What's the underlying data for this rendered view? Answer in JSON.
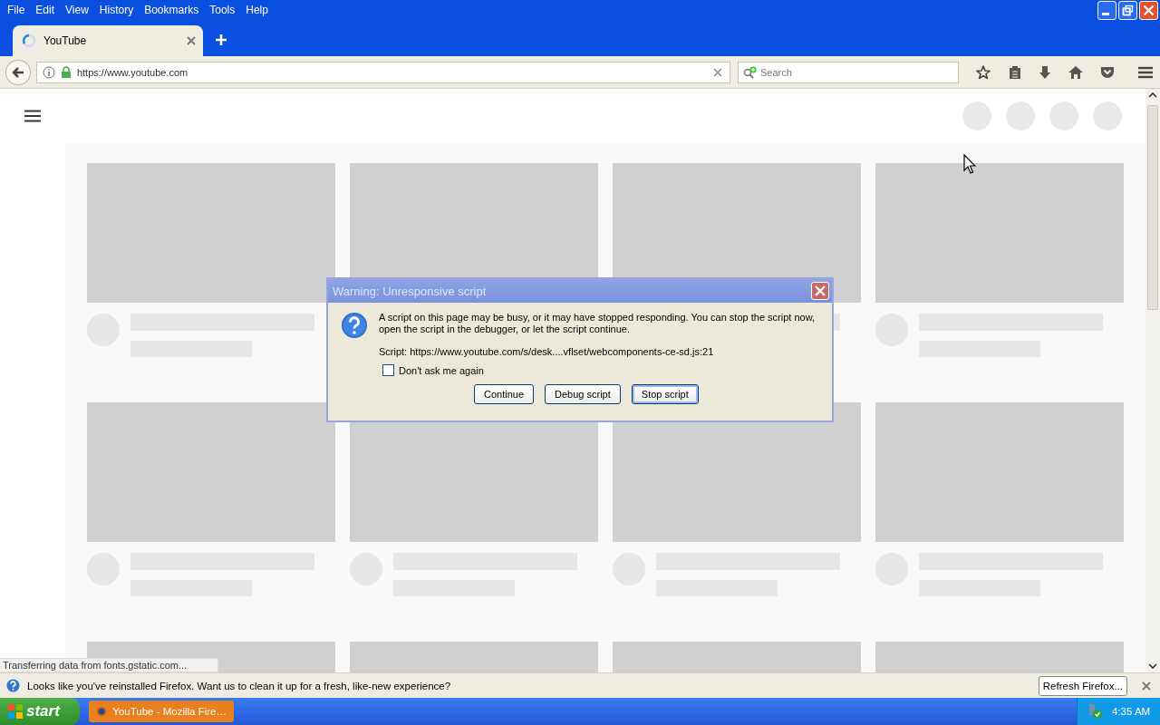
{
  "menu_bar": [
    "File",
    "Edit",
    "View",
    "History",
    "Bookmarks",
    "Tools",
    "Help"
  ],
  "tabs": [
    {
      "title": "YouTube",
      "selected": true,
      "loading": true
    }
  ],
  "address_bar": {
    "url": "https://www.youtube.com",
    "secure": true
  },
  "search": {
    "placeholder": "Search"
  },
  "dialog": {
    "title": "Warning: Unresponsive script",
    "message": "A script on this page may be busy, or it may have stopped responding. You can stop the script now, open the script in the debugger, or let the script continue.",
    "script": "Script: https://www.youtube.com/s/desk....vflset/webcomponents-ce-sd.js:21",
    "checkbox": {
      "label": "Don't ask me again",
      "checked": false
    },
    "buttons": [
      {
        "label": "Continue",
        "focused": false
      },
      {
        "label": "Debug script",
        "focused": false
      },
      {
        "label": "Stop script",
        "focused": true
      }
    ]
  },
  "status_text": "Transferring data from fonts.gstatic.com...",
  "notification": {
    "message": "Looks like you've reinstalled Firefox. Want us to clean it up for a fresh, like-new experience?",
    "button": "Refresh Firefox..."
  },
  "taskbar": {
    "start": "start",
    "tasks": [
      {
        "title": "YouTube - Mozilla Fire…",
        "selected": true
      }
    ],
    "clock": "4:35 AM"
  }
}
